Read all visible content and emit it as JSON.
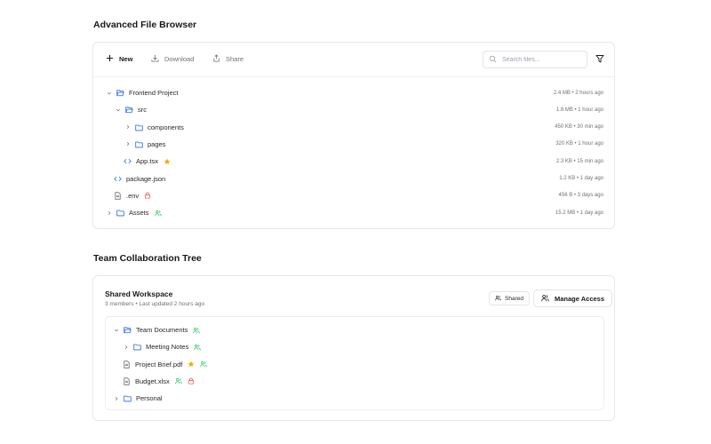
{
  "file_browser": {
    "title": "Advanced File Browser",
    "toolbar": {
      "new_label": "New",
      "download_label": "Download",
      "share_label": "Share"
    },
    "search": {
      "placeholder": "Search files...",
      "value": ""
    },
    "items": [
      {
        "name": "Frontend Project",
        "meta": "2.4 MB • 2 hours ago",
        "icon": "folder-open-icon",
        "expanded": true
      },
      {
        "name": "src",
        "meta": "1.8 MB • 1 hour ago",
        "icon": "folder-open-icon",
        "expanded": true
      },
      {
        "name": "components",
        "meta": "450 KB • 30 min ago",
        "icon": "folder-icon",
        "expanded": false
      },
      {
        "name": "pages",
        "meta": "320 KB • 1 hour ago",
        "icon": "folder-icon",
        "expanded": false
      },
      {
        "name": "App.tsx",
        "meta": "2.3 KB • 15 min ago",
        "icon": "code-file-icon",
        "badges": [
          "star-icon"
        ]
      },
      {
        "name": "package.json",
        "meta": "1.2 KB • 1 day ago",
        "icon": "code-file-icon"
      },
      {
        "name": ".env",
        "meta": "456 B • 3 days ago",
        "icon": "file-icon",
        "badges": [
          "lock-icon"
        ]
      },
      {
        "name": "Assets",
        "meta": "15.2 MB • 1 day ago",
        "icon": "folder-icon",
        "expanded": false,
        "badges": [
          "shared-icon"
        ]
      }
    ]
  },
  "team_tree": {
    "title": "Team Collaboration Tree",
    "workspace": {
      "name": "Shared Workspace",
      "subtitle": "3 members • Last updated 2 hours ago",
      "shared_badge": "Shared",
      "manage_label": "Manage Access"
    },
    "items": [
      {
        "name": "Team Documents",
        "icon": "folder-open-icon",
        "expanded": true,
        "badges": [
          "shared-icon"
        ]
      },
      {
        "name": "Meeting Notes",
        "icon": "folder-icon",
        "expanded": false,
        "badges": [
          "shared-icon"
        ]
      },
      {
        "name": "Project Brief.pdf",
        "icon": "file-icon",
        "badges": [
          "star-icon",
          "shared-icon"
        ]
      },
      {
        "name": "Budget.xlsx",
        "icon": "file-icon",
        "badges": [
          "shared-icon",
          "lock-icon"
        ]
      },
      {
        "name": "Personal",
        "icon": "folder-icon",
        "expanded": false
      }
    ]
  },
  "colors": {
    "folder": "#2563eb",
    "star": "#eab308",
    "lock": "#ef4444",
    "shared": "#22c55e",
    "muted": "#71717a"
  }
}
